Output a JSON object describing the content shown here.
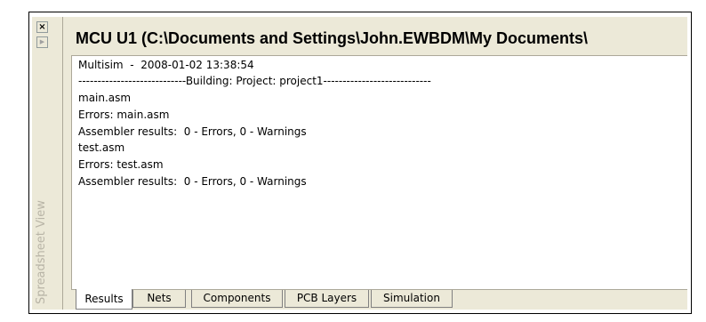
{
  "sidebar": {
    "close_glyph": "×",
    "arrow_glyph": "▶",
    "label": "Spreadsheet View"
  },
  "panel": {
    "title": "MCU U1 (C:\\Documents and Settings\\John.EWBDM\\My Documents\\"
  },
  "output": {
    "lines": [
      "Multisim  -  2008-01-02 13:38:54",
      "----------------------------Building: Project: project1----------------------------",
      "main.asm",
      "Errors: main.asm",
      "Assembler results:  0 - Errors, 0 - Warnings",
      "test.asm",
      "Errors: test.asm",
      "Assembler results:  0 - Errors, 0 - Warnings"
    ]
  },
  "tabs": [
    {
      "label": "Results",
      "active": true
    },
    {
      "label": "Nets",
      "active": false
    },
    {
      "label": "Components",
      "active": false
    },
    {
      "label": "PCB Layers",
      "active": false
    },
    {
      "label": "Simulation",
      "active": false
    }
  ]
}
